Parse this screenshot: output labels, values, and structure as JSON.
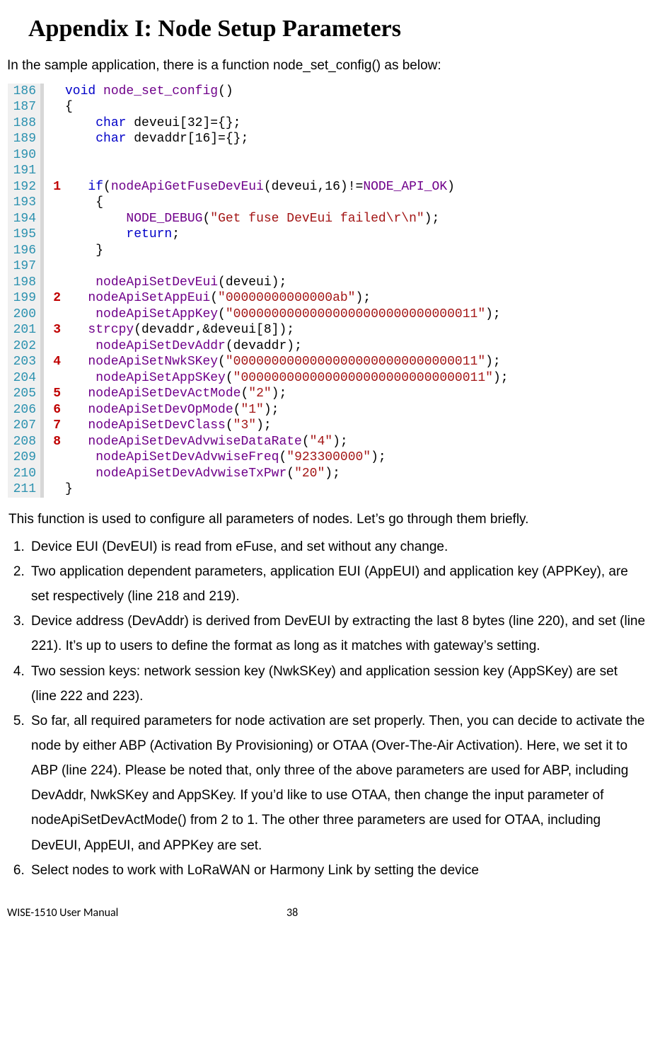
{
  "title": "Appendix I: Node Setup Parameters",
  "intro": "In the sample application, there is a function node_set_config() as below:",
  "code": {
    "lines": [
      {
        "n": "186",
        "anno": "",
        "html": "<span class='kw'>void</span> <span class='fn'>node_set_config</span>()"
      },
      {
        "n": "187",
        "anno": "",
        "html": "{"
      },
      {
        "n": "188",
        "anno": "",
        "html": "    <span class='kw'>char</span> deveui[32]={};"
      },
      {
        "n": "189",
        "anno": "",
        "html": "    <span class='kw'>char</span> devaddr[16]={};"
      },
      {
        "n": "190",
        "anno": "",
        "html": ""
      },
      {
        "n": "191",
        "anno": "",
        "html": ""
      },
      {
        "n": "192",
        "anno": "1",
        "html": "   <span class='kw'>if</span>(<span class='fn'>nodeApiGetFuseDevEui</span>(deveui,16)!=<span class='mc'>NODE_API_OK</span>)"
      },
      {
        "n": "193",
        "anno": "",
        "html": "    {"
      },
      {
        "n": "194",
        "anno": "",
        "html": "        <span class='mc'>NODE_DEBUG</span>(<span class='st'>\"Get fuse DevEui failed\\r\\n\"</span>);"
      },
      {
        "n": "195",
        "anno": "",
        "html": "        <span class='kw'>return</span>;"
      },
      {
        "n": "196",
        "anno": "",
        "html": "    }"
      },
      {
        "n": "197",
        "anno": "",
        "html": ""
      },
      {
        "n": "198",
        "anno": "",
        "html": "    <span class='fn'>nodeApiSetDevEui</span>(deveui);"
      },
      {
        "n": "199",
        "anno": "2",
        "html": "   <span class='fn'>nodeApiSetAppEui</span>(<span class='st'>\"00000000000000ab\"</span>);"
      },
      {
        "n": "200",
        "anno": "",
        "html": "    <span class='fn'>nodeApiSetAppKey</span>(<span class='st'>\"00000000000000000000000000000011\"</span>);"
      },
      {
        "n": "201",
        "anno": "3",
        "html": "   <span class='fn'>strcpy</span>(devaddr,&amp;deveui[8]);"
      },
      {
        "n": "202",
        "anno": "",
        "html": "    <span class='fn'>nodeApiSetDevAddr</span>(devaddr);"
      },
      {
        "n": "203",
        "anno": "4",
        "html": "   <span class='fn'>nodeApiSetNwkSKey</span>(<span class='st'>\"00000000000000000000000000000011\"</span>);"
      },
      {
        "n": "204",
        "anno": "",
        "html": "    <span class='fn'>nodeApiSetAppSKey</span>(<span class='st'>\"00000000000000000000000000000011\"</span>);"
      },
      {
        "n": "205",
        "anno": "5",
        "html": "   <span class='fn'>nodeApiSetDevActMode</span>(<span class='st'>\"2\"</span>);"
      },
      {
        "n": "206",
        "anno": "6",
        "html": "   <span class='fn'>nodeApiSetDevOpMode</span>(<span class='st'>\"1\"</span>);"
      },
      {
        "n": "207",
        "anno": "7",
        "html": "   <span class='fn'>nodeApiSetDevClass</span>(<span class='st'>\"3\"</span>);"
      },
      {
        "n": "208",
        "anno": "8",
        "html": "   <span class='fn'>nodeApiSetDevAdvwiseDataRate</span>(<span class='st'>\"4\"</span>);"
      },
      {
        "n": "209",
        "anno": "",
        "html": "    <span class='fn'>nodeApiSetDevAdvwiseFreq</span>(<span class='st'>\"923300000\"</span>);"
      },
      {
        "n": "210",
        "anno": "",
        "html": "    <span class='fn'>nodeApiSetDevAdvwiseTxPwr</span>(<span class='st'>\"20\"</span>);"
      },
      {
        "n": "211",
        "anno": "",
        "html": "}"
      }
    ]
  },
  "body": "This function is used to configure all parameters of nodes. Let’s go through them briefly.",
  "list": [
    "Device EUI (DevEUI) is read from eFuse, and set without any change.",
    "Two application dependent parameters, application EUI (AppEUI) and application key (APPKey), are set respectively (line 218 and 219).",
    "Device address (DevAddr) is derived from DevEUI by extracting the last 8 bytes (line 220), and set (line 221). It’s up to users to define the format as long as it matches with gateway’s setting.",
    "Two session keys: network session key (NwkSKey) and application session key (AppSKey) are set (line 222 and 223).",
    "So far, all required parameters for node activation are set properly. Then, you can decide to activate the node by either ABP (Activation By Provisioning) or OTAA (Over-The-Air Activation). Here, we set it to ABP (line 224). Please be noted that, only three of the above parameters are used for ABP, including DevAddr, NwkSKey and AppSKey. If you’d like to use OTAA, then change the input parameter of nodeApiSetDevActMode() from 2 to 1. The other three parameters are used for OTAA, including DevEUI, AppEUI, and APPKey are set.",
    "Select nodes to work with LoRaWAN or Harmony Link by setting the device"
  ],
  "footer": {
    "doc": "WISE-1510 User Manual",
    "page": "38"
  }
}
